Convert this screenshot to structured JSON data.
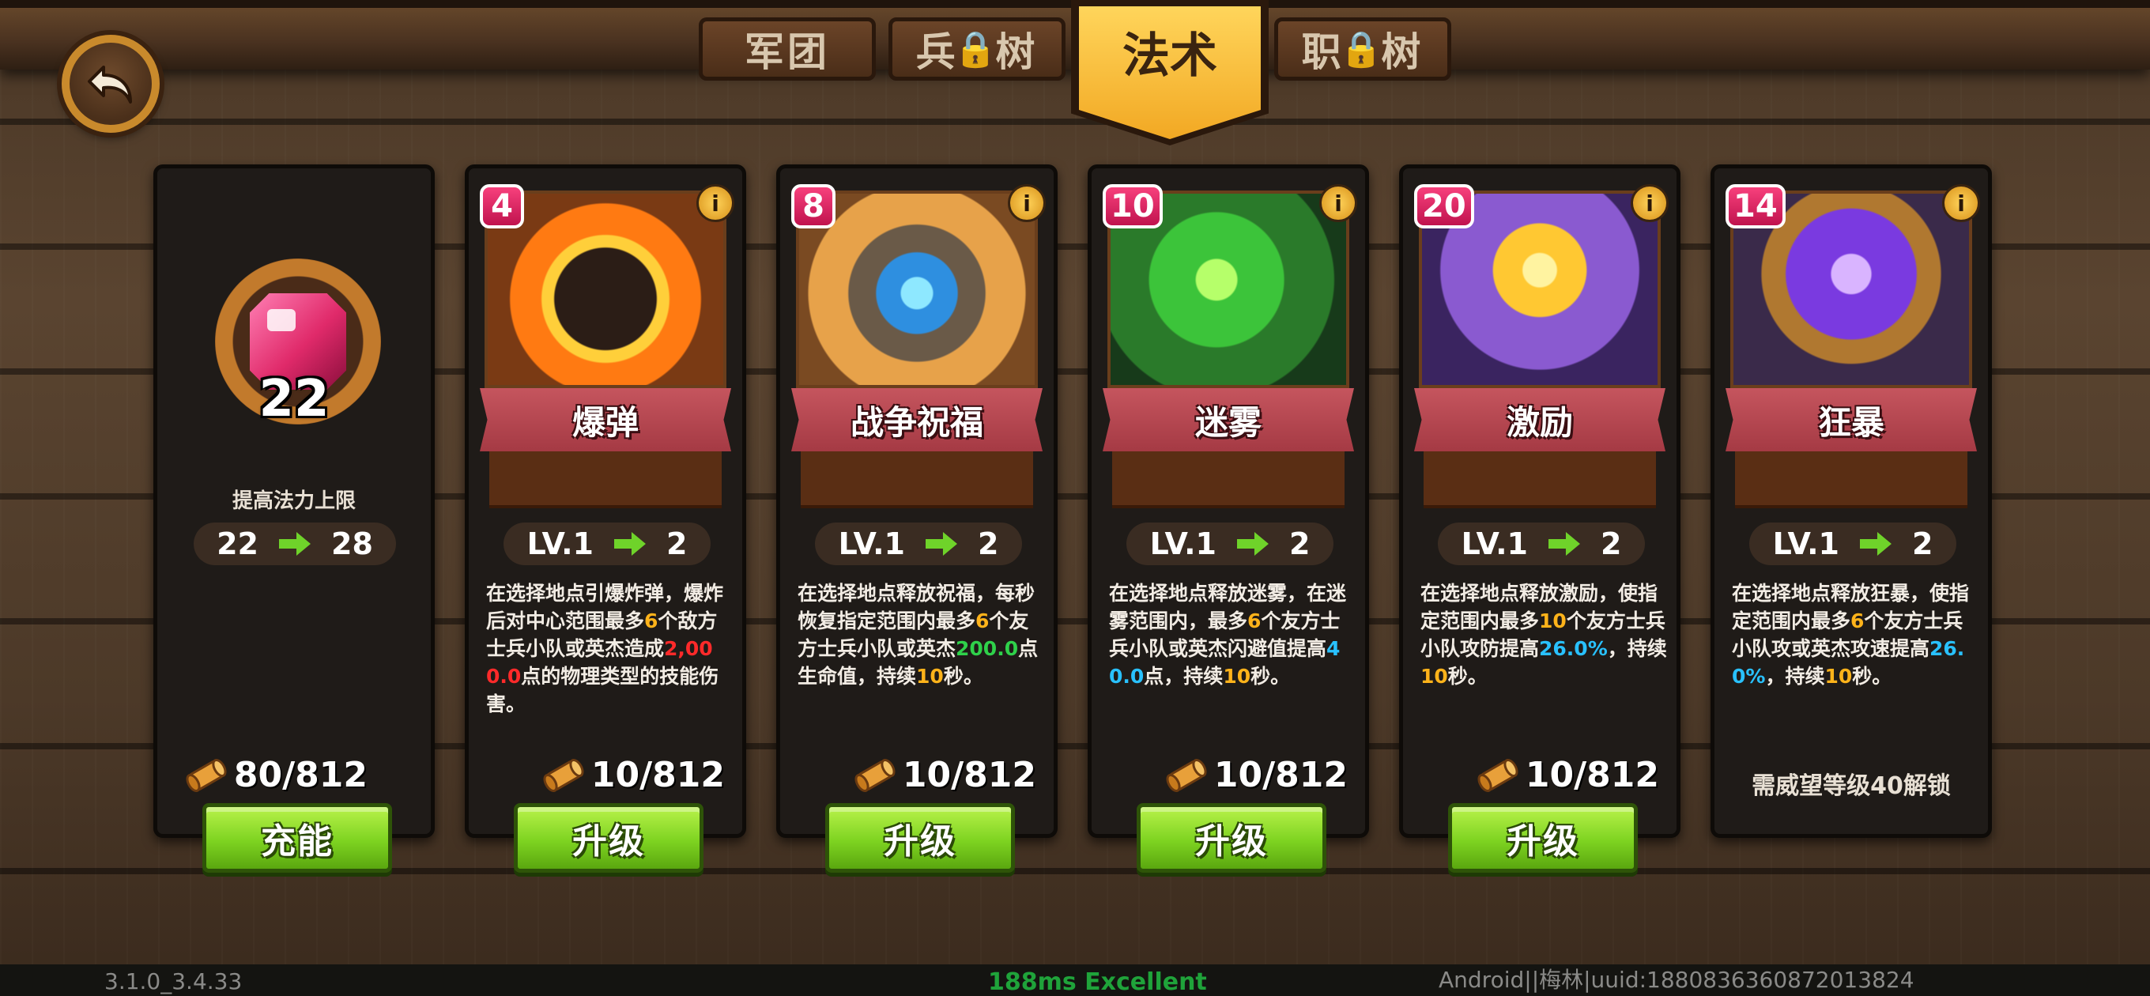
{
  "tabs": [
    {
      "label_a": "军团",
      "label_b": "",
      "locked": false
    },
    {
      "label_a": "兵",
      "label_b": "树",
      "locked": true
    },
    {
      "label_a": "法术",
      "label_b": "",
      "locked": false,
      "active": true
    },
    {
      "label_a": "职",
      "label_b": "树",
      "locked": true
    }
  ],
  "mana": {
    "gem_count": "22",
    "label": "提高法力上限",
    "from": "22",
    "to": "28",
    "cost": "80/812",
    "button": "充能"
  },
  "spells": [
    {
      "cost": "4",
      "name": "爆弹",
      "lv_from": "LV.1",
      "lv_to": "2",
      "desc": [
        [
          "在选择地点引爆炸弹，爆炸后对中心范围最多",
          ""
        ],
        [
          "6",
          "orange"
        ],
        [
          "个敌方士兵小队或英杰造成",
          ""
        ],
        [
          "2,000.0",
          "red"
        ],
        [
          "点的物理类型的技能伤害。",
          ""
        ]
      ],
      "resource": "10/812",
      "button": "升级"
    },
    {
      "cost": "8",
      "name": "战争祝福",
      "lv_from": "LV.1",
      "lv_to": "2",
      "desc": [
        [
          "在选择地点释放祝福，每秒恢复指定范围内最多",
          ""
        ],
        [
          "6",
          "orange"
        ],
        [
          "个友方士兵小队或英杰",
          ""
        ],
        [
          "200.0",
          "green"
        ],
        [
          "点生命值，持续",
          ""
        ],
        [
          "10",
          "orange"
        ],
        [
          "秒。",
          ""
        ]
      ],
      "resource": "10/812",
      "button": "升级"
    },
    {
      "cost": "10",
      "name": "迷雾",
      "lv_from": "LV.1",
      "lv_to": "2",
      "desc": [
        [
          "在选择地点释放迷雾，在迷雾范围内，最多",
          ""
        ],
        [
          "6",
          "orange"
        ],
        [
          "个友方士兵小队或英杰闪避值提高",
          ""
        ],
        [
          "40.0",
          "blue"
        ],
        [
          "点，持续",
          ""
        ],
        [
          "10",
          "orange"
        ],
        [
          "秒。",
          ""
        ]
      ],
      "resource": "10/812",
      "button": "升级"
    },
    {
      "cost": "20",
      "name": "激励",
      "lv_from": "LV.1",
      "lv_to": "2",
      "desc": [
        [
          "在选择地点释放激励，使指定范围内最多",
          ""
        ],
        [
          "10",
          "orange"
        ],
        [
          "个友方士兵小队攻防提高",
          ""
        ],
        [
          "26.0%",
          "blue"
        ],
        [
          "，持续",
          ""
        ],
        [
          "10",
          "orange"
        ],
        [
          "秒。",
          ""
        ]
      ],
      "resource": "10/812",
      "button": "升级"
    },
    {
      "cost": "14",
      "name": "狂暴",
      "lv_from": "LV.1",
      "lv_to": "2",
      "desc": [
        [
          "在选择地点释放狂暴，使指定范围内最多",
          ""
        ],
        [
          "6",
          "orange"
        ],
        [
          "个友方士兵小队攻或英杰攻速提高",
          ""
        ],
        [
          "26.0%",
          "blue"
        ],
        [
          "，持续",
          ""
        ],
        [
          "10",
          "orange"
        ],
        [
          "秒。",
          ""
        ]
      ],
      "unlock": "需威望等级40解锁"
    }
  ],
  "footer": {
    "version": "3.1.0_3.4.33",
    "ping": "188ms Excellent",
    "device": "Android||梅林|uuid:1880836360872013824"
  },
  "colors": {
    "accent_gold": "#f2a823",
    "button_green": "#7ed321",
    "card_red": "#c5555e",
    "cost_pink": "#f7407c"
  }
}
